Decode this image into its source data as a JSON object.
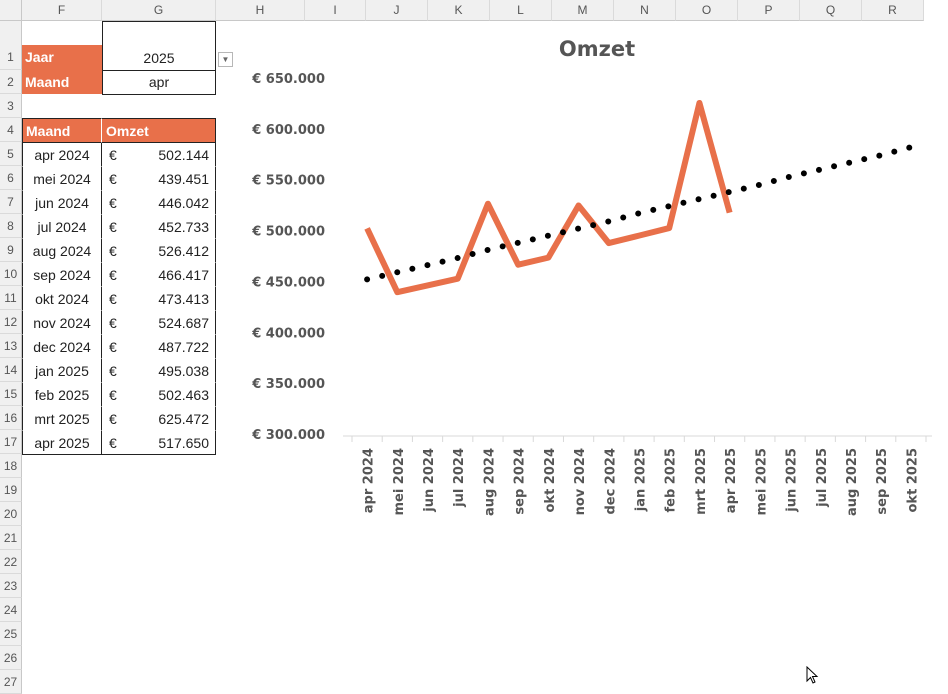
{
  "columns": [
    "F",
    "G",
    "H",
    "I",
    "J",
    "K",
    "L",
    "M",
    "N",
    "O",
    "P",
    "Q",
    "R"
  ],
  "rows": [
    "1",
    "2",
    "3",
    "4",
    "5",
    "6",
    "7",
    "8",
    "9",
    "10",
    "11",
    "12",
    "13",
    "14",
    "15",
    "16",
    "17",
    "18",
    "19",
    "20",
    "21",
    "22",
    "23",
    "24",
    "25",
    "26",
    "27"
  ],
  "filter": {
    "year_label": "Jaar",
    "year_value": "2025",
    "month_label": "Maand",
    "month_value": "apr"
  },
  "table": {
    "headers": [
      "Maand",
      "Omzet"
    ],
    "currency": "€",
    "rows": [
      {
        "month": "apr 2024",
        "value": "502.144"
      },
      {
        "month": "mei 2024",
        "value": "439.451"
      },
      {
        "month": "jun 2024",
        "value": "446.042"
      },
      {
        "month": "jul 2024",
        "value": "452.733"
      },
      {
        "month": "aug 2024",
        "value": "526.412"
      },
      {
        "month": "sep 2024",
        "value": "466.417"
      },
      {
        "month": "okt 2024",
        "value": "473.413"
      },
      {
        "month": "nov 2024",
        "value": "524.687"
      },
      {
        "month": "dec 2024",
        "value": "487.722"
      },
      {
        "month": "jan 2025",
        "value": "495.038"
      },
      {
        "month": "feb 2025",
        "value": "502.463"
      },
      {
        "month": "mrt 2025",
        "value": "625.472"
      },
      {
        "month": "apr 2025",
        "value": "517.650"
      }
    ]
  },
  "colors": {
    "accent": "#e8704a",
    "trend": "#000000"
  },
  "chart_data": {
    "type": "line",
    "title": "Omzet",
    "categories": [
      "apr 2024",
      "mei 2024",
      "jun 2024",
      "jul 2024",
      "aug 2024",
      "sep 2024",
      "okt 2024",
      "nov 2024",
      "dec 2024",
      "jan 2025",
      "feb 2025",
      "mrt 2025",
      "apr 2025",
      "mei 2025",
      "jun 2025",
      "jul 2025",
      "aug 2025",
      "sep 2025",
      "okt 2025"
    ],
    "series": [
      {
        "values": [
          502144,
          439451,
          446042,
          452733,
          526412,
          466417,
          473413,
          524687,
          487722,
          495038,
          502463,
          625472,
          517650
        ],
        "color": "#e8704a",
        "style": "solid"
      },
      {
        "values": [
          452000,
          459000,
          466000,
          473000,
          481000,
          488000,
          495000,
          502000,
          509000,
          517000,
          524000,
          531000,
          538000,
          545000,
          553000,
          560000,
          567000,
          574000,
          582000
        ],
        "color": "#000000",
        "style": "dotted",
        "role": "trendline"
      }
    ],
    "yticks": [
      "€ 300.000",
      "€ 350.000",
      "€ 400.000",
      "€ 450.000",
      "€ 500.000",
      "€ 550.000",
      "€ 600.000",
      "€ 650.000"
    ],
    "ylim": [
      300000,
      650000
    ],
    "grid": false,
    "legend": "none"
  }
}
